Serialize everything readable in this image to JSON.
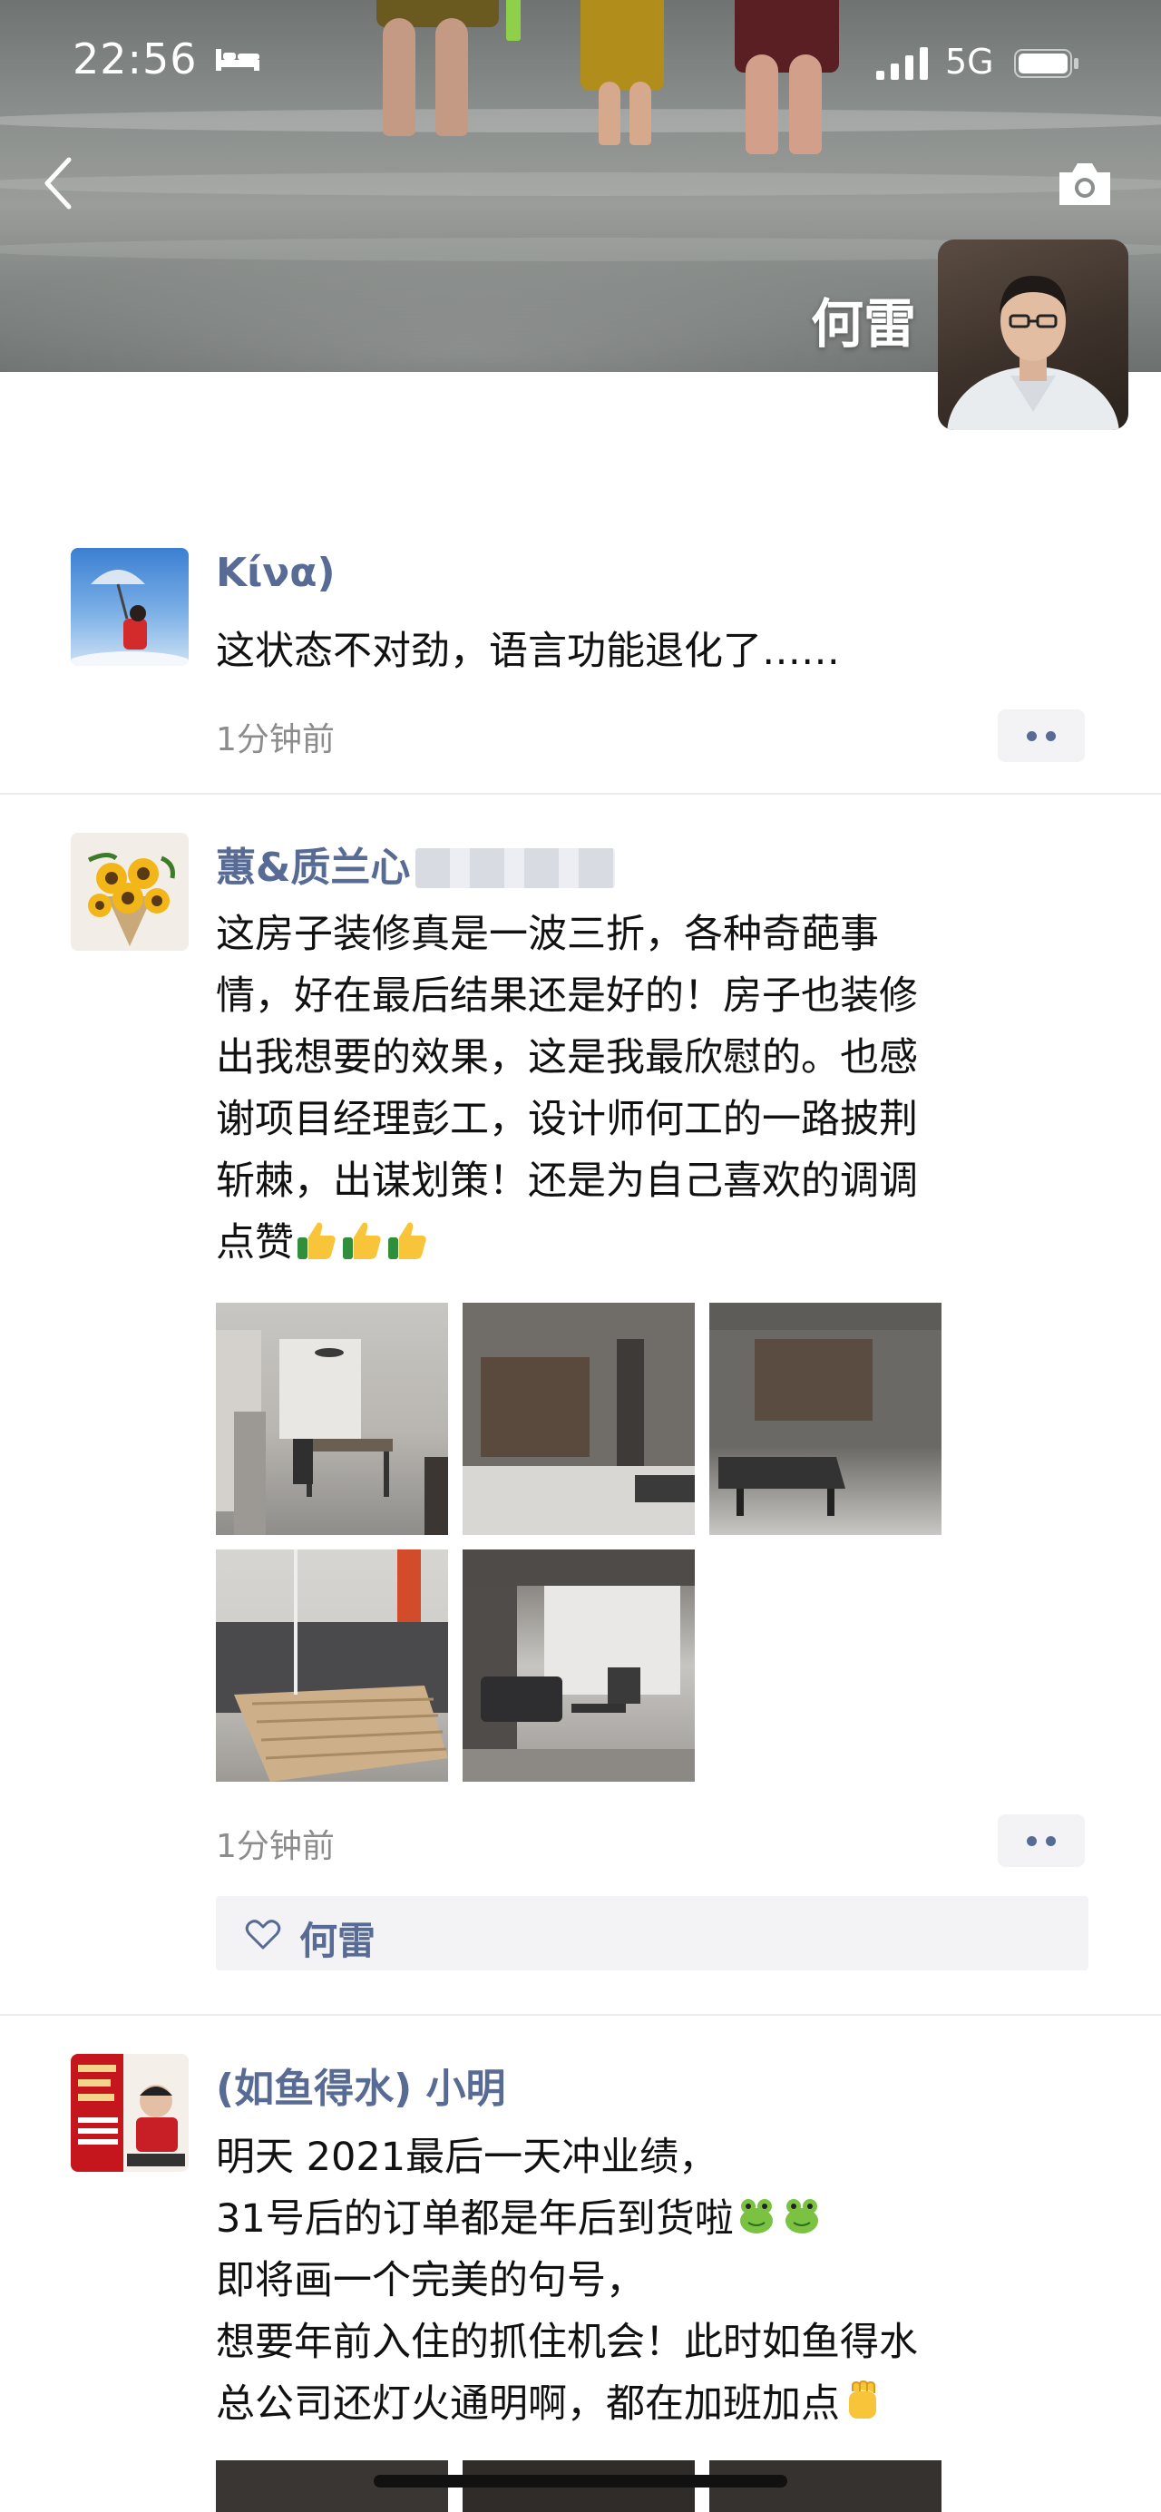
{
  "status_bar": {
    "time": "22:56",
    "network": "5G"
  },
  "cover": {
    "owner_name": "何雷"
  },
  "posts": [
    {
      "author": "Kίνα)",
      "content_lines": [
        "这状态不对劲，语言功能退化了……"
      ],
      "time": "1分钟前"
    },
    {
      "author": "蕙&质兰心",
      "content_lines": [
        "这房子装修真是一波三折，各种奇葩事",
        "情，好在最后结果还是好的！房子也装修",
        "出我想要的效果，这是我最欣慰的。也感",
        "谢项目经理彭工，设计师何工的一路披荆",
        "斩棘，出谋划策！还是为自己喜欢的调调",
        "点赞"
      ],
      "emojis": [
        "thumbs-up",
        "thumbs-up",
        "thumbs-up"
      ],
      "photo_count": 5,
      "time": "1分钟前",
      "likes": [
        "何雷"
      ]
    },
    {
      "author": "(如鱼得水) 小明",
      "content_lines": [
        "明天 2021最后一天冲业绩，",
        "31号后的订单都是年后到货啦",
        "即将画一个完美的句号，",
        "想要年前入住的抓住机会！此时如鱼得水",
        "总公司还灯火通明啊，都在加班加点"
      ],
      "emojis_line2": [
        "frog",
        "frog"
      ],
      "emojis_line5": [
        "fist"
      ]
    }
  ],
  "colors": {
    "author": "#576b95",
    "time": "#8c8c8c",
    "likes_bg": "#f3f3f5"
  }
}
